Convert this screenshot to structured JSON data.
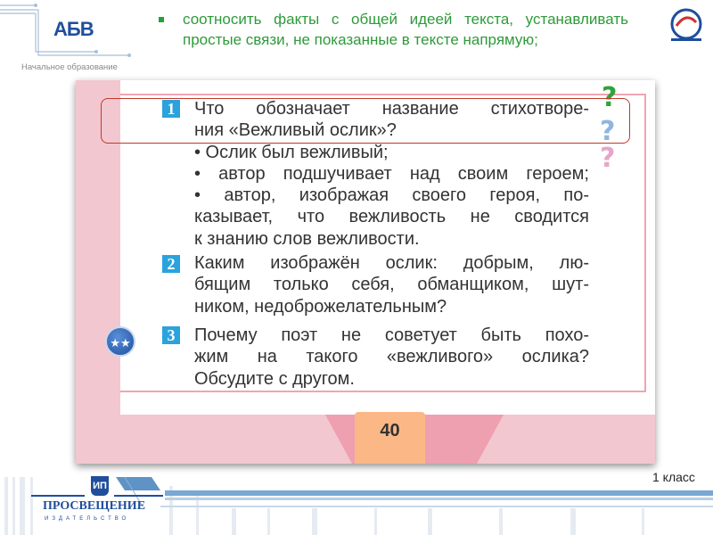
{
  "header": {
    "logo": "АБВ",
    "logo_subtitle": "Начальное образование",
    "bullet_text": "соотносить факты с общей идеей текста, устанавливать простые связи, не показанные в тексте напрямую;"
  },
  "textbook": {
    "questions": [
      {
        "number": "1",
        "lines": [
          "Что обозначает название стихотворе-",
          "ния «Вежливый ослик»?"
        ]
      },
      {
        "number": "2",
        "lines": [
          "Каким изображён ослик: добрым, лю-",
          "бящим только себя, обманщиком, шут-",
          "ником, недоброжелательным?"
        ]
      },
      {
        "number": "3",
        "lines": [
          "Почему поэт не советует быть похо-",
          "жим на такого «вежливого» ослика?",
          "Обсудите с другом."
        ]
      }
    ],
    "options": [
      "• Ослик был вежливый;",
      "• автор подшучивает над своим героем;",
      "• автор, изображая своего героя, по-",
      "казывает, что вежливость не сводится",
      "к знанию слов вежливости."
    ],
    "page_number": "40",
    "question_marks": [
      "?",
      "?",
      "?"
    ]
  },
  "footer": {
    "grade": "1 класс",
    "publisher": "ПРОСВЕЩЕНИЕ",
    "publisher_sub": "ИЗДАТЕЛЬСТВО",
    "publisher_logo": "ИП"
  },
  "colors": {
    "green": "#2e9a3a",
    "blue": "#1f4e9c",
    "highlight": "#c0392b"
  }
}
